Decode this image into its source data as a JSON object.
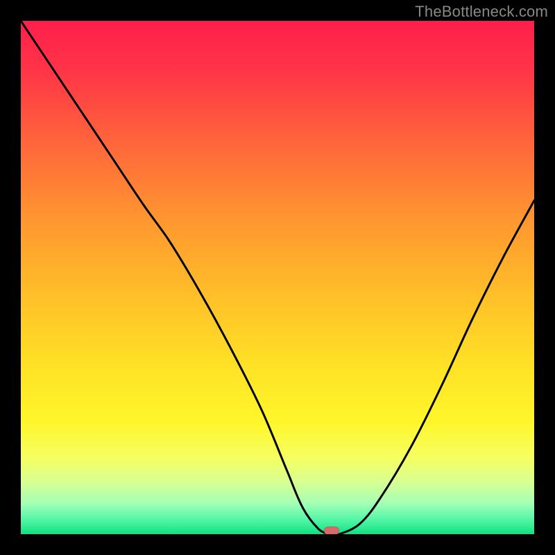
{
  "watermark": "TheBottleneck.com",
  "colors": {
    "frame_bg": "#000000",
    "watermark": "#888888",
    "curve_stroke": "#000000",
    "marker_fill": "#d86a6a",
    "gradient_stops": [
      {
        "offset": 0.0,
        "color": "#ff1f4c"
      },
      {
        "offset": 0.1,
        "color": "#ff3547"
      },
      {
        "offset": 0.25,
        "color": "#ff6a3a"
      },
      {
        "offset": 0.4,
        "color": "#ff9a2f"
      },
      {
        "offset": 0.55,
        "color": "#ffc328"
      },
      {
        "offset": 0.68,
        "color": "#ffe326"
      },
      {
        "offset": 0.78,
        "color": "#fff62a"
      },
      {
        "offset": 0.85,
        "color": "#f6ff60"
      },
      {
        "offset": 0.9,
        "color": "#d6ff93"
      },
      {
        "offset": 0.94,
        "color": "#a4ffb5"
      },
      {
        "offset": 0.97,
        "color": "#57f7a8"
      },
      {
        "offset": 1.0,
        "color": "#10e07f"
      }
    ]
  },
  "chart_data": {
    "type": "line",
    "title": "",
    "xlabel": "",
    "ylabel": "",
    "xlim": [
      0,
      1
    ],
    "ylim": [
      0,
      1
    ],
    "grid": false,
    "legend": false,
    "series": [
      {
        "name": "bottleneck-curve",
        "x": [
          0.0,
          0.06,
          0.12,
          0.18,
          0.24,
          0.29,
          0.35,
          0.41,
          0.47,
          0.52,
          0.55,
          0.58,
          0.6,
          0.62,
          0.66,
          0.7,
          0.76,
          0.82,
          0.88,
          0.94,
          1.0
        ],
        "y": [
          1.0,
          0.91,
          0.82,
          0.73,
          0.64,
          0.57,
          0.47,
          0.36,
          0.24,
          0.12,
          0.05,
          0.01,
          0.0,
          0.0,
          0.02,
          0.07,
          0.17,
          0.29,
          0.42,
          0.54,
          0.65
        ]
      }
    ],
    "marker": {
      "x": 0.605,
      "y": 0.0
    },
    "notes": "y is fraction of plot height from bottom; background is a vertical red→green gradient; curve minimum touches y=0 near x≈0.60–0.62"
  }
}
